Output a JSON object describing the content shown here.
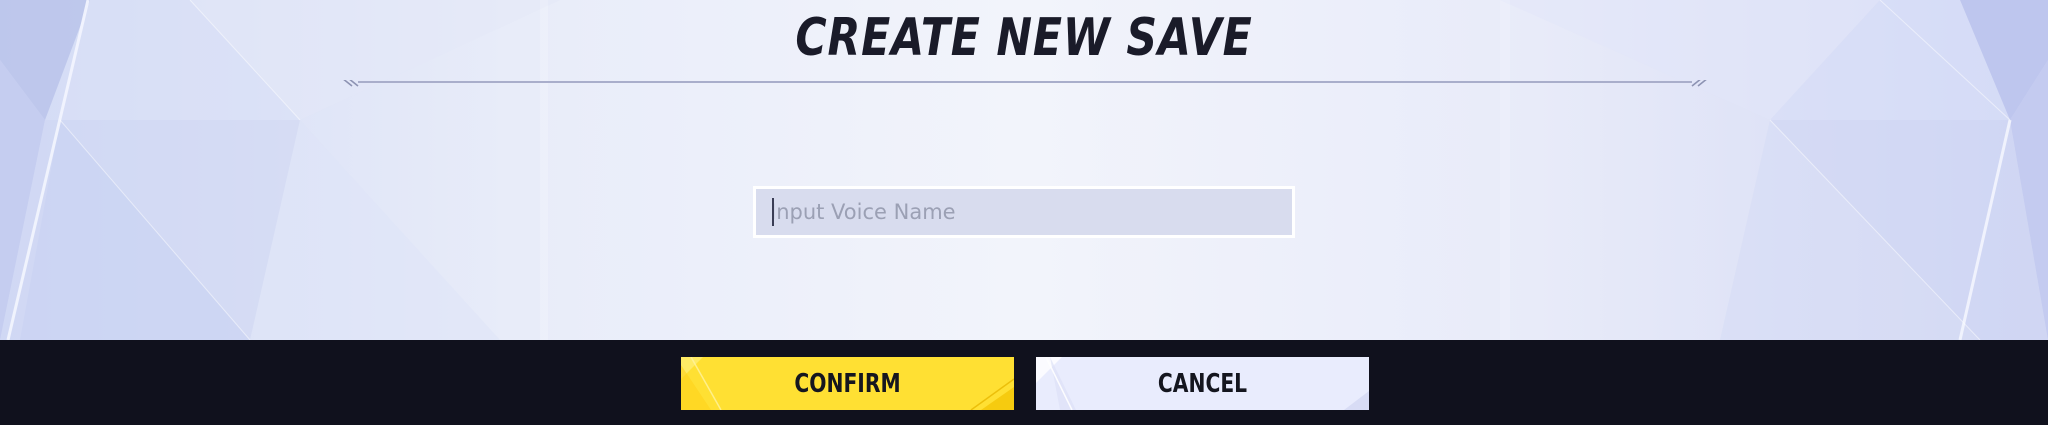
{
  "dialog": {
    "title": "CREATE NEW SAVE",
    "name_input": {
      "value": "",
      "placeholder": "Input Voice Name"
    },
    "buttons": {
      "confirm_label": "CONFIRM",
      "cancel_label": "CANCEL"
    }
  },
  "colors": {
    "panel_light": "#f2f4fb",
    "panel_edge": "#d3dbf5",
    "title_text": "#1a1b29",
    "rule_line": "#a9aecb",
    "footer_bar": "#10111d",
    "confirm_bg": "#ffe033",
    "cancel_bg": "#e9ecfd",
    "input_bg": "#d8dcee",
    "input_border": "#ffffff",
    "placeholder_text": "#9ba0b4"
  },
  "icons": {
    "rule_left_end": "double-slash-icon",
    "rule_right_end": "double-slash-icon"
  }
}
